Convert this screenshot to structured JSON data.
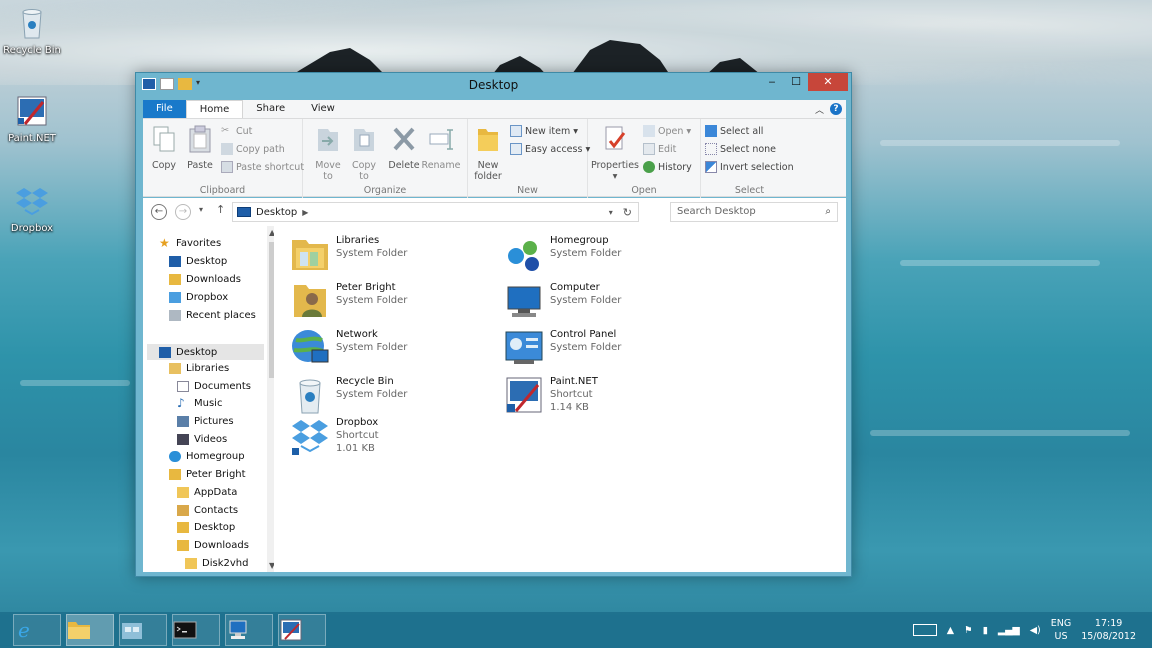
{
  "desktop": {
    "icons": [
      {
        "label": "Recycle Bin",
        "icon": "recycle-bin-icon"
      },
      {
        "label": "Paint.NET",
        "icon": "paint-net-icon"
      },
      {
        "label": "Dropbox",
        "icon": "dropbox-icon"
      }
    ]
  },
  "window": {
    "title": "Desktop",
    "controls": {
      "minimize": "‒",
      "maximize": "☐",
      "close": "✕"
    },
    "tabs": [
      "File",
      "Home",
      "Share",
      "View"
    ],
    "help": "?",
    "ribbon": {
      "clipboard": {
        "label": "Clipboard",
        "copy": "Copy",
        "paste": "Paste",
        "cut": "Cut",
        "copy_path": "Copy path",
        "paste_shortcut": "Paste shortcut"
      },
      "organize": {
        "label": "Organize",
        "move_to": "Move",
        "move_to2": "to",
        "copy_to": "Copy",
        "copy_to2": "to",
        "delete": "Delete",
        "rename": "Rename"
      },
      "new": {
        "label": "New",
        "new_folder": "New",
        "new_folder2": "folder",
        "new_item": "New item",
        "easy_access": "Easy access"
      },
      "open": {
        "label": "Open",
        "properties": "Properties",
        "open": "Open",
        "edit": "Edit",
        "history": "History"
      },
      "select": {
        "label": "Select",
        "select_all": "Select all",
        "select_none": "Select none",
        "invert": "Invert selection"
      }
    },
    "address": {
      "location": "Desktop",
      "search_placeholder": "Search Desktop"
    },
    "nav": {
      "favorites": "Favorites",
      "fav_items": [
        "Desktop",
        "Downloads",
        "Dropbox",
        "Recent places"
      ],
      "desktop": "Desktop",
      "libraries": "Libraries",
      "lib_items": [
        "Documents",
        "Music",
        "Pictures",
        "Videos"
      ],
      "homegroup": "Homegroup",
      "user": "Peter Bright",
      "user_items": [
        "AppData",
        "Contacts",
        "Desktop",
        "Downloads",
        "Disk2vhd"
      ]
    },
    "items": [
      {
        "name": "Libraries",
        "type": "System Folder",
        "size": ""
      },
      {
        "name": "Homegroup",
        "type": "System Folder",
        "size": ""
      },
      {
        "name": "Peter Bright",
        "type": "System Folder",
        "size": ""
      },
      {
        "name": "Computer",
        "type": "System Folder",
        "size": ""
      },
      {
        "name": "Network",
        "type": "System Folder",
        "size": ""
      },
      {
        "name": "Control Panel",
        "type": "System Folder",
        "size": ""
      },
      {
        "name": "Recycle Bin",
        "type": "System Folder",
        "size": ""
      },
      {
        "name": "Paint.NET",
        "type": "Shortcut",
        "size": "1.14 KB"
      },
      {
        "name": "Dropbox",
        "type": "Shortcut",
        "size": "1.01 KB"
      }
    ]
  },
  "taskbar": {
    "apps": [
      "internet-explorer-icon",
      "file-explorer-icon",
      "windows-store-icon",
      "command-prompt-icon",
      "remote-desktop-icon",
      "paint-net-icon"
    ],
    "lang_top": "ENG",
    "lang_bottom": "US",
    "time": "17:19",
    "date": "15/08/2012"
  },
  "colors": {
    "accent": "#1979ca",
    "window_frame": "#6fb6cf",
    "close": "#c7463a",
    "taskbar": "#1c6e8c"
  }
}
